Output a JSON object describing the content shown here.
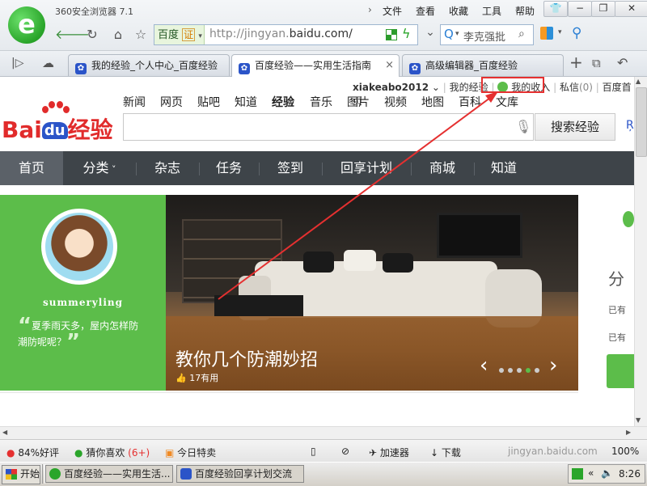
{
  "browser": {
    "title": "360安全浏览器 7.1",
    "menu": [
      "文件",
      "查看",
      "收藏",
      "工具",
      "帮助"
    ],
    "window_buttons": [
      "−",
      "❐",
      "✕"
    ],
    "address": {
      "security_label": "百度",
      "cert_badge": "证",
      "url_prefix": "http://jingyan.",
      "url_domain": "baidu.com/"
    },
    "search_box": {
      "text": "李克强批"
    },
    "tabs": [
      {
        "label": "我的经验_个人中心_百度经验"
      },
      {
        "label": "百度经验——实用生活指南"
      },
      {
        "label": "高级编辑器_百度经验"
      }
    ]
  },
  "page": {
    "user_bar": {
      "username": "xiakeabo2012",
      "my_experience": "我的经验",
      "my_income": "我的收入",
      "messages": "私信",
      "messages_count": "(0)",
      "homepage": "百度首页"
    },
    "top_nav": [
      "新闻",
      "网页",
      "贴吧",
      "知道",
      "经验",
      "音乐",
      "图片",
      "视频",
      "地图",
      "百科",
      "文库"
    ],
    "logo": {
      "bai": "Bai",
      "du": "du",
      "jy": "经验"
    },
    "search_button": "搜索经验",
    "category_nav": [
      "首页",
      "分类",
      "杂志",
      "任务",
      "签到",
      "回享计划",
      "商城",
      "知道"
    ],
    "banner": {
      "username": "summeryling",
      "quote": "夏季雨天多，屋内怎样防潮防呢呢？",
      "title": "教你几个防潮妙招",
      "likes": "17有用"
    },
    "right_panel": {
      "label1": "分",
      "text1": "已有",
      "text2": "已有"
    }
  },
  "status_bar": {
    "rating": "84%好评",
    "guess": "猜你喜欢",
    "guess_count": "(6+)",
    "deals": "今日特卖",
    "accelerator": "加速器",
    "download": "下载",
    "zoom": "100%"
  },
  "taskbar": {
    "start": "开始",
    "tasks": [
      "百度经验——实用生活...",
      "百度经验回享计划交流"
    ],
    "clock": "8:26"
  },
  "watermark": "jingyan.baidu.com",
  "colors": {
    "accent_green": "#5cbd4a",
    "nav_dark": "#3e4449",
    "annotation_red": "#e53030",
    "baidu_red": "#e12b2b",
    "baidu_blue": "#2b54c8"
  }
}
